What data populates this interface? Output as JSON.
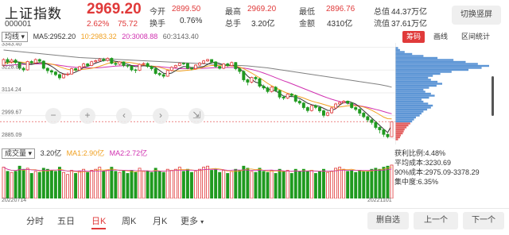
{
  "header": {
    "name": "上证指数",
    "code": "000001",
    "price": "2969.20",
    "change_pct": "2.62%",
    "change": "75.72",
    "stats": [
      {
        "label": "今开",
        "value": "2899.50",
        "red": true
      },
      {
        "label": "换手",
        "value": "0.76%",
        "red": false
      },
      {
        "label": "最高",
        "value": "2969.20",
        "red": true
      },
      {
        "label": "总手",
        "value": "3.20亿",
        "red": false
      },
      {
        "label": "最低",
        "value": "2896.76",
        "red": true
      },
      {
        "label": "金额",
        "value": "4310亿",
        "red": false
      },
      {
        "label": "总值",
        "value": "44.37万亿",
        "red": false
      },
      {
        "label": "流值",
        "value": "37.61万亿",
        "red": false
      }
    ],
    "portrait_button": "切换竖屏"
  },
  "ma_legend": {
    "selector": "均线",
    "ma5": "MA5:2952.20",
    "ma10": "10:2983.32",
    "ma20": "20:3008.88",
    "ma60": "60:3143.40"
  },
  "chip_tabs": [
    "筹码",
    "画线",
    "区间统计"
  ],
  "price_axis": [
    "3343.40",
    "3228.82",
    "3114.24",
    "2999.67",
    "2885.09"
  ],
  "dates": {
    "start": "20220714",
    "end": "20221101"
  },
  "volume_legend": {
    "selector": "成交量",
    "total": "3.20亿",
    "ma1": "MA1:2.90亿",
    "ma2": "MA2:2.72亿"
  },
  "chip_stats": {
    "profit_ratio": "获利比例:4.48%",
    "avg_cost": "平均成本:3230.69",
    "cost_90": "90%成本:2975.09-3378.29",
    "concentration": "集中度:6.35%"
  },
  "nav_buttons": [
    "−",
    "+",
    "‹",
    "›",
    "⇲"
  ],
  "periods": [
    "分时",
    "五日",
    "日K",
    "周K",
    "月K",
    "更多"
  ],
  "active_period": "日K",
  "actions": [
    "删自选",
    "上一个",
    "下一个"
  ],
  "colors": {
    "up": "#e03a3a",
    "down": "#1f9a1f",
    "ma5": "#333333",
    "ma10": "#f0a020",
    "ma20": "#d030b0",
    "ma60": "#808080",
    "chip_blue": "#4a8ad0",
    "chip_red": "#e05050"
  },
  "chart_data": {
    "type": "candlestick",
    "ylim": [
      2870,
      3350
    ],
    "candles": [
      [
        3252,
        3282,
        3245,
        3288
      ],
      [
        3282,
        3270,
        3258,
        3292
      ],
      [
        3270,
        3279,
        3262,
        3287
      ],
      [
        3279,
        3267,
        3259,
        3286
      ],
      [
        3267,
        3238,
        3230,
        3270
      ],
      [
        3238,
        3230,
        3220,
        3246
      ],
      [
        3230,
        3272,
        3226,
        3276
      ],
      [
        3272,
        3265,
        3257,
        3279
      ],
      [
        3265,
        3282,
        3260,
        3288
      ],
      [
        3282,
        3274,
        3266,
        3287
      ],
      [
        3274,
        3238,
        3232,
        3278
      ],
      [
        3238,
        3226,
        3212,
        3243
      ],
      [
        3226,
        3219,
        3205,
        3232
      ],
      [
        3219,
        3206,
        3198,
        3225
      ],
      [
        3206,
        3190,
        3180,
        3212
      ],
      [
        3190,
        3207,
        3186,
        3212
      ],
      [
        3207,
        3209,
        3198,
        3218
      ],
      [
        3209,
        3236,
        3206,
        3240
      ],
      [
        3236,
        3229,
        3222,
        3242
      ],
      [
        3229,
        3246,
        3224,
        3250
      ],
      [
        3246,
        3260,
        3242,
        3266
      ],
      [
        3260,
        3252,
        3245,
        3265
      ],
      [
        3252,
        3271,
        3248,
        3276
      ],
      [
        3271,
        3276,
        3266,
        3283
      ],
      [
        3276,
        3283,
        3270,
        3290
      ],
      [
        3283,
        3278,
        3271,
        3291
      ],
      [
        3278,
        3288,
        3272,
        3293
      ],
      [
        3288,
        3263,
        3258,
        3293
      ],
      [
        3263,
        3258,
        3250,
        3270
      ],
      [
        3258,
        3270,
        3253,
        3274
      ],
      [
        3270,
        3252,
        3244,
        3273
      ],
      [
        3252,
        3249,
        3240,
        3258
      ],
      [
        3249,
        3230,
        3222,
        3252
      ],
      [
        3230,
        3228,
        3214,
        3236
      ],
      [
        3228,
        3258,
        3224,
        3262
      ],
      [
        3258,
        3262,
        3252,
        3268
      ],
      [
        3262,
        3247,
        3240,
        3268
      ],
      [
        3247,
        3236,
        3226,
        3252
      ],
      [
        3236,
        3212,
        3205,
        3240
      ],
      [
        3212,
        3206,
        3198,
        3218
      ],
      [
        3206,
        3198,
        3188,
        3212
      ],
      [
        3198,
        3227,
        3195,
        3230
      ],
      [
        3227,
        3243,
        3222,
        3248
      ],
      [
        3243,
        3252,
        3238,
        3256
      ],
      [
        3252,
        3263,
        3248,
        3266
      ],
      [
        3263,
        3262,
        3254,
        3268
      ],
      [
        3262,
        3238,
        3233,
        3266
      ],
      [
        3238,
        3236,
        3228,
        3244
      ],
      [
        3236,
        3254,
        3232,
        3258
      ],
      [
        3254,
        3264,
        3248,
        3270
      ],
      [
        3264,
        3275,
        3259,
        3280
      ],
      [
        3275,
        3282,
        3270,
        3286
      ],
      [
        3282,
        3270,
        3262,
        3284
      ],
      [
        3270,
        3247,
        3240,
        3274
      ],
      [
        3247,
        3238,
        3232,
        3250
      ],
      [
        3238,
        3260,
        3234,
        3264
      ],
      [
        3260,
        3252,
        3244,
        3266
      ],
      [
        3252,
        3267,
        3248,
        3272
      ],
      [
        3267,
        3236,
        3228,
        3270
      ],
      [
        3236,
        3222,
        3210,
        3240
      ],
      [
        3222,
        3180,
        3170,
        3228
      ],
      [
        3180,
        3168,
        3152,
        3186
      ],
      [
        3168,
        3192,
        3162,
        3196
      ],
      [
        3192,
        3185,
        3176,
        3198
      ],
      [
        3185,
        3148,
        3140,
        3190
      ],
      [
        3148,
        3139,
        3130,
        3156
      ],
      [
        3139,
        3121,
        3112,
        3146
      ],
      [
        3121,
        3143,
        3116,
        3148
      ],
      [
        3143,
        3126,
        3119,
        3148
      ],
      [
        3126,
        3093,
        3083,
        3130
      ],
      [
        3093,
        3088,
        3078,
        3100
      ],
      [
        3088,
        3108,
        3083,
        3112
      ],
      [
        3108,
        3101,
        3093,
        3114
      ],
      [
        3101,
        3072,
        3064,
        3106
      ],
      [
        3072,
        3063,
        3054,
        3080
      ],
      [
        3063,
        3040,
        3030,
        3068
      ],
      [
        3040,
        3025,
        3015,
        3046
      ],
      [
        3025,
        3050,
        3020,
        3054
      ],
      [
        3050,
        3041,
        3032,
        3056
      ],
      [
        3041,
        3024,
        3014,
        3046
      ],
      [
        3024,
        3001,
        2990,
        3030
      ],
      [
        3001,
        3014,
        2996,
        3020
      ],
      [
        3014,
        3038,
        3008,
        3044
      ],
      [
        3038,
        3058,
        3032,
        3064
      ],
      [
        3058,
        3066,
        3052,
        3072
      ],
      [
        3066,
        3072,
        3060,
        3078
      ],
      [
        3072,
        3062,
        3055,
        3076
      ],
      [
        3062,
        3040,
        3034,
        3068
      ],
      [
        3040,
        3031,
        3022,
        3046
      ],
      [
        3031,
        3012,
        2998,
        3036
      ],
      [
        3012,
        2994,
        2986,
        3018
      ],
      [
        2994,
        2978,
        2966,
        3000
      ],
      [
        2978,
        2965,
        2954,
        2984
      ],
      [
        2965,
        2940,
        2930,
        2970
      ],
      [
        2940,
        2928,
        2910,
        2945
      ],
      [
        2928,
        2905,
        2892,
        2932
      ],
      [
        2905,
        2893,
        2885,
        2910
      ],
      [
        2893,
        2969,
        2892,
        2970
      ]
    ],
    "ma5": [
      3268,
      3270,
      3272,
      3273,
      3268,
      3261,
      3258,
      3257,
      3262,
      3266,
      3267,
      3258,
      3248,
      3234,
      3218,
      3210,
      3207,
      3211,
      3219,
      3229,
      3242,
      3248,
      3255,
      3264,
      3271,
      3277,
      3279,
      3277,
      3273,
      3270,
      3263,
      3259,
      3252,
      3246,
      3248,
      3251,
      3249,
      3247,
      3242,
      3227,
      3213,
      3210,
      3214,
      3226,
      3238,
      3247,
      3245,
      3242,
      3242,
      3244,
      3247,
      3258,
      3268,
      3268,
      3262,
      3255,
      3252,
      3253,
      3249,
      3236,
      3220,
      3198,
      3182,
      3168,
      3162,
      3145,
      3135,
      3127,
      3124,
      3111,
      3098,
      3095,
      3096,
      3093,
      3086,
      3075,
      3062,
      3055,
      3050,
      3046,
      3036,
      3026,
      3025,
      3034,
      3052,
      3066,
      3072,
      3066,
      3058,
      3042,
      3024,
      3006,
      2988,
      2969,
      2950,
      2932,
      2914,
      2952
    ],
    "ma10": [
      3262,
      3265,
      3268,
      3270,
      3270,
      3268,
      3267,
      3266,
      3266,
      3266,
      3264,
      3262,
      3259,
      3254,
      3246,
      3239,
      3233,
      3229,
      3229,
      3231,
      3233,
      3235,
      3238,
      3242,
      3248,
      3255,
      3262,
      3267,
      3269,
      3270,
      3270,
      3268,
      3266,
      3262,
      3258,
      3254,
      3251,
      3249,
      3247,
      3243,
      3237,
      3231,
      3227,
      3225,
      3224,
      3226,
      3228,
      3230,
      3233,
      3238,
      3244,
      3249,
      3252,
      3252,
      3251,
      3251,
      3251,
      3250,
      3249,
      3244,
      3236,
      3225,
      3214,
      3202,
      3190,
      3176,
      3162,
      3150,
      3140,
      3130,
      3120,
      3112,
      3107,
      3101,
      3095,
      3088,
      3080,
      3073,
      3067,
      3062,
      3056,
      3050,
      3044,
      3042,
      3043,
      3046,
      3049,
      3050,
      3049,
      3047,
      3043,
      3036,
      3027,
      3016,
      3004,
      2992,
      2984,
      2983
    ],
    "ma20": [
      3250,
      3252,
      3254,
      3256,
      3257,
      3258,
      3259,
      3260,
      3260,
      3260,
      3260,
      3259,
      3258,
      3256,
      3253,
      3250,
      3247,
      3245,
      3243,
      3242,
      3241,
      3240,
      3240,
      3240,
      3241,
      3243,
      3245,
      3247,
      3249,
      3250,
      3251,
      3252,
      3252,
      3252,
      3252,
      3251,
      3250,
      3249,
      3248,
      3246,
      3244,
      3242,
      3240,
      3238,
      3237,
      3236,
      3236,
      3236,
      3236,
      3237,
      3238,
      3239,
      3240,
      3241,
      3241,
      3242,
      3242,
      3242,
      3242,
      3241,
      3239,
      3236,
      3232,
      3227,
      3221,
      3214,
      3207,
      3199,
      3191,
      3183,
      3175,
      3168,
      3160,
      3152,
      3144,
      3136,
      3128,
      3120,
      3112,
      3104,
      3096,
      3089,
      3082,
      3076,
      3071,
      3066,
      3061,
      3057,
      3053,
      3049,
      3045,
      3041,
      3036,
      3031,
      3026,
      3020,
      3014,
      3009
    ],
    "ma60": [
      3330,
      3328,
      3326,
      3324,
      3322,
      3320,
      3318,
      3316,
      3314,
      3312,
      3310,
      3308,
      3306,
      3304,
      3302,
      3300,
      3298,
      3296,
      3294,
      3292,
      3291,
      3290,
      3289,
      3288,
      3287,
      3286,
      3285,
      3284,
      3283,
      3282,
      3281,
      3280,
      3279,
      3278,
      3277,
      3276,
      3275,
      3274,
      3273,
      3272,
      3271,
      3270,
      3269,
      3268,
      3267,
      3266,
      3265,
      3264,
      3263,
      3262,
      3261,
      3260,
      3259,
      3258,
      3257,
      3256,
      3255,
      3254,
      3253,
      3252,
      3251,
      3250,
      3248,
      3246,
      3244,
      3242,
      3240,
      3237,
      3234,
      3231,
      3228,
      3225,
      3222,
      3219,
      3216,
      3213,
      3210,
      3207,
      3204,
      3201,
      3198,
      3195,
      3192,
      3189,
      3186,
      3183,
      3180,
      3177,
      3174,
      3171,
      3168,
      3165,
      3162,
      3159,
      3156,
      3152,
      3148,
      3143
    ],
    "volume": [
      3.0,
      2.6,
      2.5,
      2.6,
      3.1,
      2.8,
      2.9,
      2.4,
      2.6,
      2.5,
      2.9,
      2.8,
      2.7,
      2.6,
      3.0,
      2.5,
      2.3,
      2.7,
      2.4,
      2.6,
      2.8,
      2.5,
      2.7,
      2.8,
      3.0,
      2.6,
      2.7,
      3.0,
      2.6,
      2.5,
      2.7,
      2.4,
      2.7,
      2.5,
      2.9,
      2.6,
      2.6,
      2.5,
      2.9,
      2.6,
      2.5,
      2.8,
      2.7,
      2.8,
      3.0,
      2.6,
      2.8,
      2.5,
      2.6,
      2.8,
      3.0,
      3.1,
      2.7,
      2.8,
      2.5,
      2.7,
      2.4,
      2.6,
      2.8,
      2.7,
      3.1,
      2.9,
      2.6,
      2.5,
      2.9,
      2.6,
      2.5,
      2.7,
      2.4,
      2.8,
      2.6,
      2.7,
      2.4,
      2.8,
      2.6,
      2.8,
      2.6,
      2.7,
      2.4,
      2.6,
      2.8,
      2.5,
      2.6,
      2.9,
      3.0,
      2.8,
      2.6,
      2.7,
      2.5,
      2.7,
      2.6,
      2.6,
      2.8,
      2.9,
      2.8,
      3.0,
      3.1,
      3.2
    ],
    "chip_profile": [
      [
        3340,
        3
      ],
      [
        3330,
        5
      ],
      [
        3320,
        10
      ],
      [
        3310,
        18
      ],
      [
        3300,
        30
      ],
      [
        3290,
        45
      ],
      [
        3280,
        62
      ],
      [
        3270,
        75
      ],
      [
        3260,
        88
      ],
      [
        3250,
        100
      ],
      [
        3240,
        92
      ],
      [
        3230,
        78
      ],
      [
        3220,
        60
      ],
      [
        3210,
        48
      ],
      [
        3200,
        40
      ],
      [
        3190,
        35
      ],
      [
        3180,
        38
      ],
      [
        3170,
        45
      ],
      [
        3160,
        50
      ],
      [
        3150,
        44
      ],
      [
        3140,
        36
      ],
      [
        3130,
        30
      ],
      [
        3120,
        32
      ],
      [
        3110,
        38
      ],
      [
        3100,
        42
      ],
      [
        3090,
        36
      ],
      [
        3080,
        28
      ],
      [
        3070,
        30
      ],
      [
        3060,
        35
      ],
      [
        3050,
        40
      ],
      [
        3040,
        38
      ],
      [
        3030,
        34
      ],
      [
        3020,
        30
      ],
      [
        3010,
        28
      ],
      [
        3000,
        26
      ],
      [
        2990,
        22
      ],
      [
        2980,
        20
      ],
      [
        2970,
        18
      ],
      [
        2960,
        16
      ],
      [
        2950,
        14
      ],
      [
        2940,
        12
      ],
      [
        2930,
        10
      ],
      [
        2920,
        9
      ],
      [
        2910,
        8
      ],
      [
        2900,
        6
      ],
      [
        2890,
        5
      ],
      [
        2880,
        3
      ]
    ]
  }
}
